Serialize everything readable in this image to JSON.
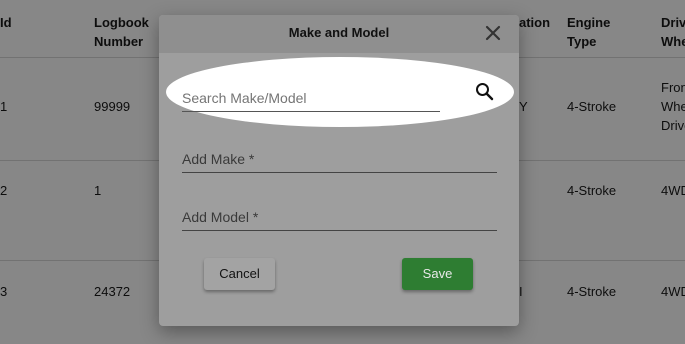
{
  "table": {
    "headers": {
      "id": "Id",
      "logbook": "Logbook Number",
      "registration": "ation",
      "engine": "Engine Type",
      "drive": "Drive Wheels"
    },
    "rows": [
      {
        "id": "1",
        "logbook": "99999",
        "registration": "Y",
        "engine": "4-Stroke",
        "drive": "Front Wheel Drive"
      },
      {
        "id": "2",
        "logbook": "1",
        "registration": "",
        "engine": "4-Stroke",
        "drive": "4WD"
      },
      {
        "id": "3",
        "logbook": "24372",
        "registration": "I",
        "engine": "4-Stroke",
        "drive": "4WD"
      }
    ]
  },
  "dialog": {
    "title": "Make and Model",
    "close_icon": "close-icon",
    "search": {
      "placeholder": "Search Make/Model",
      "value": "",
      "icon": "search-icon"
    },
    "make": {
      "placeholder": "Add Make *",
      "value": ""
    },
    "model": {
      "placeholder": "Add Model *",
      "value": ""
    },
    "cancel_label": "Cancel",
    "save_label": "Save"
  },
  "colors": {
    "overlay": "#000000",
    "dialog_bg": "#9e9e9e",
    "save_button": "#2e7d32",
    "highlight": "#ffffff"
  }
}
